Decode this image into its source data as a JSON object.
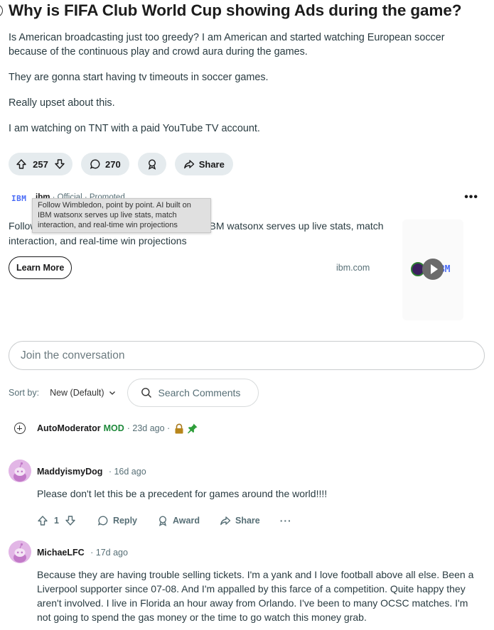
{
  "post": {
    "title": "Why is FIFA Club World Cup showing Ads during the game?",
    "paragraphs": [
      "Is American broadcasting just too greedy? I am American and started watching European soccer because of the continuous play and crowd aura during the games.",
      "They are gonna start having tv timeouts in soccer games.",
      "Really upset about this.",
      "I am watching on TNT with a paid YouTube TV account."
    ],
    "votes": "257",
    "comments": "270",
    "share_label": "Share"
  },
  "ad": {
    "logo_text": "IBM",
    "author": "ibm",
    "official": "· Official",
    "promoted": "· Promoted",
    "text": "Follow Wimbledon, point by point. AI built on IBM watsonx serves up live stats, match interaction, and real-time win projections",
    "tooltip": "Follow Wimbledon, point by point. AI built on IBM watsonx serves up live stats, match interaction, and real-time win projections",
    "cta": "Learn More",
    "domain": "ibm.com",
    "more": "•••",
    "media_logo": "IBM"
  },
  "conversation": {
    "placeholder": "Join the conversation",
    "sort_label": "Sort by:",
    "sort_value": "New (Default)",
    "search_label": "Search Comments"
  },
  "automod": {
    "username": "AutoModerator",
    "badge": "MOD",
    "time": "· 23d ago ·"
  },
  "comments": [
    {
      "username": "MaddyismyDog",
      "time": "· 16d ago",
      "text": "Please don't let this be a precedent for games around the world!!!!",
      "votes": "1",
      "reply_label": "Reply",
      "award_label": "Award",
      "share_label": "Share",
      "more": "···"
    },
    {
      "username": "MichaeLFC",
      "time": "· 17d ago",
      "text": "Because they are having trouble selling tickets. I'm a yank and I love football above all else. Been a Liverpool supporter since 07-08. And I'm appalled by this farce of a competition. Quite happy they aren't involved. I live in Florida an hour away from Orlando. I've been to many OCSC matches. I'm not going to spend the gas money or the time to go watch this money grab."
    }
  ]
}
